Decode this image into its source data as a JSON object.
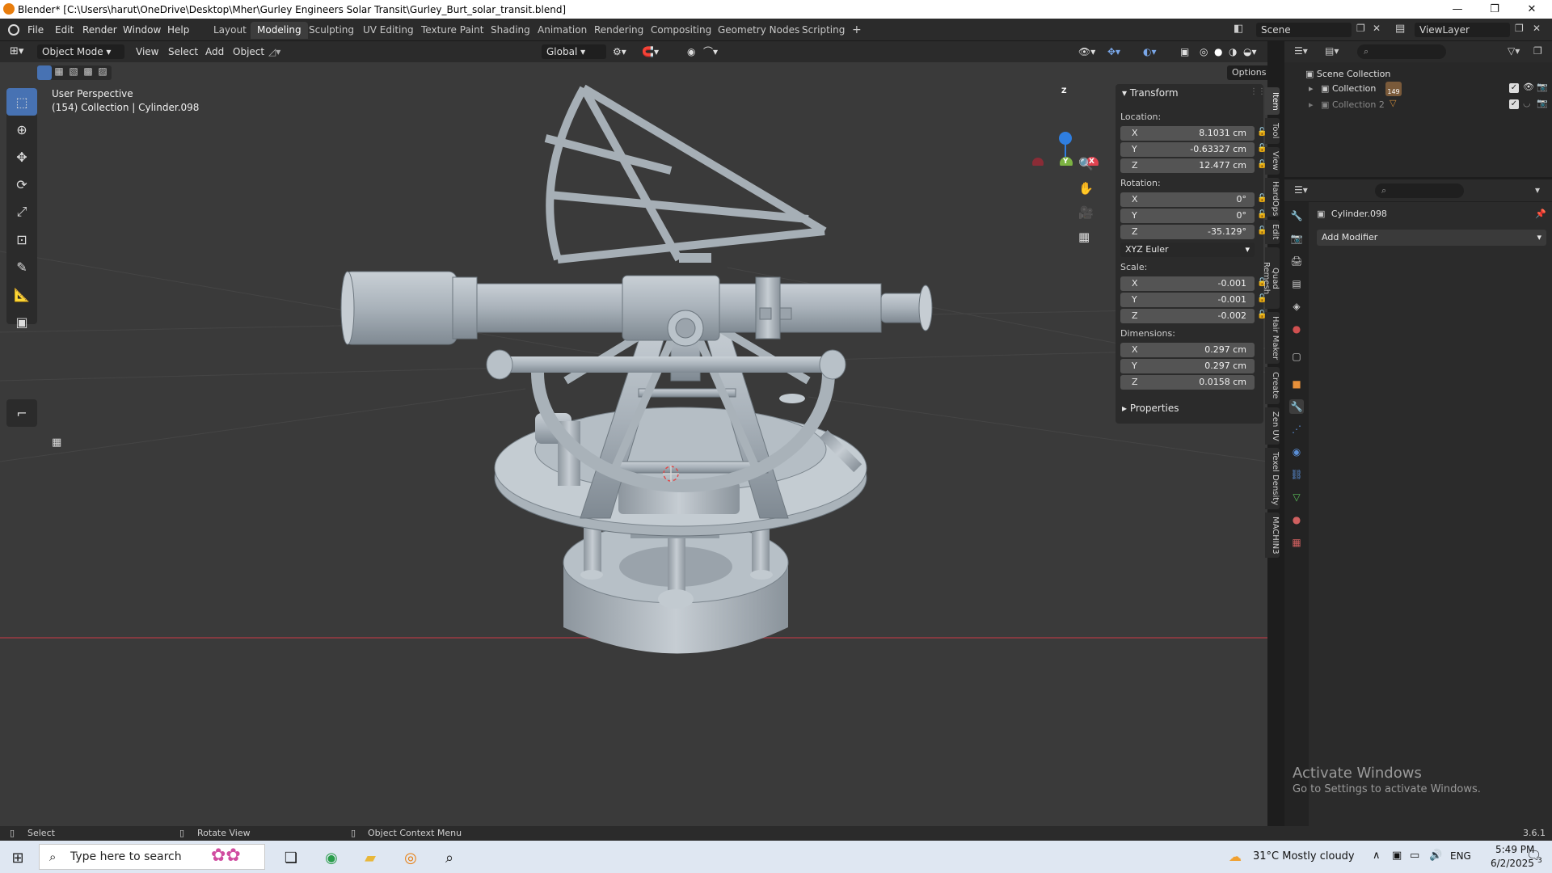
{
  "window": {
    "title": "Blender* [C:\\Users\\harut\\OneDrive\\Desktop\\Mher\\Gurley Engineers Solar Transit\\Gurley_Burt_solar_transit.blend]",
    "controls": [
      "—",
      "❐",
      "✕"
    ]
  },
  "menu": [
    "File",
    "Edit",
    "Render",
    "Window",
    "Help"
  ],
  "workspaces": {
    "tabs": [
      "Layout",
      "Modeling",
      "Sculpting",
      "UV Editing",
      "Texture Paint",
      "Shading",
      "Animation",
      "Rendering",
      "Compositing",
      "Geometry Nodes",
      "Scripting"
    ],
    "active": "Modeling",
    "add": "+"
  },
  "scene": {
    "label": "Scene",
    "view_layer": "ViewLayer"
  },
  "viewport_header": {
    "mode": "Object Mode",
    "menus": [
      "View",
      "Select",
      "Add",
      "Object"
    ],
    "transform_orientation": "Global",
    "options": "Options"
  },
  "overlay_text": {
    "perspective": "User Perspective",
    "collection_info": "(154) Collection | Cylinder.098"
  },
  "gizmo": {
    "z": "Z",
    "y": "Y",
    "x": "X"
  },
  "npanel": {
    "transform_title": "Transform",
    "location_label": "Location:",
    "location": [
      {
        "axis": "X",
        "value": "8.1031 cm"
      },
      {
        "axis": "Y",
        "value": "-0.63327 cm"
      },
      {
        "axis": "Z",
        "value": "12.477 cm"
      }
    ],
    "rotation_label": "Rotation:",
    "rotation": [
      {
        "axis": "X",
        "value": "0°"
      },
      {
        "axis": "Y",
        "value": "0°"
      },
      {
        "axis": "Z",
        "value": "-35.129°"
      }
    ],
    "rotation_mode": "XYZ Euler",
    "scale_label": "Scale:",
    "scale": [
      {
        "axis": "X",
        "value": "-0.001"
      },
      {
        "axis": "Y",
        "value": "-0.001"
      },
      {
        "axis": "Z",
        "value": "-0.002"
      }
    ],
    "dimensions_label": "Dimensions:",
    "dimensions": [
      {
        "axis": "X",
        "value": "0.297 cm"
      },
      {
        "axis": "Y",
        "value": "0.297 cm"
      },
      {
        "axis": "Z",
        "value": "0.0158 cm"
      }
    ],
    "properties_title": "Properties",
    "side_tabs": [
      "Item",
      "Tool",
      "View",
      "HardOps",
      "Edit",
      "Quad Remesh",
      "Hair Maker",
      "Create",
      "Zen UV",
      "Texel Density",
      "MACHIN3"
    ]
  },
  "outliner": {
    "root": "Scene Collection",
    "items": [
      {
        "label": "Collection",
        "badge": "149"
      },
      {
        "label": "Collection 2"
      }
    ]
  },
  "properties": {
    "object_name": "Cylinder.098",
    "add_modifier": "Add Modifier"
  },
  "activate_windows": {
    "title": "Activate Windows",
    "subtitle": "Go to Settings to activate Windows."
  },
  "statusbar": {
    "select": "Select",
    "rotate": "Rotate View",
    "context": "Object Context Menu",
    "version": "3.6.1"
  },
  "taskbar": {
    "search_placeholder": "Type here to search",
    "weather": "31°C  Mostly cloudy",
    "lang": "ENG",
    "time": "5:49 PM",
    "date": "6/2/2025",
    "notifications": "3"
  },
  "colors": {
    "accent": "#4772b3",
    "viewport_bg": "#3a3a3a",
    "panel_bg": "#2b2b2b",
    "gizmo_x": "#e0424f",
    "gizmo_y": "#7cb342",
    "gizmo_z": "#2f7ee0"
  }
}
